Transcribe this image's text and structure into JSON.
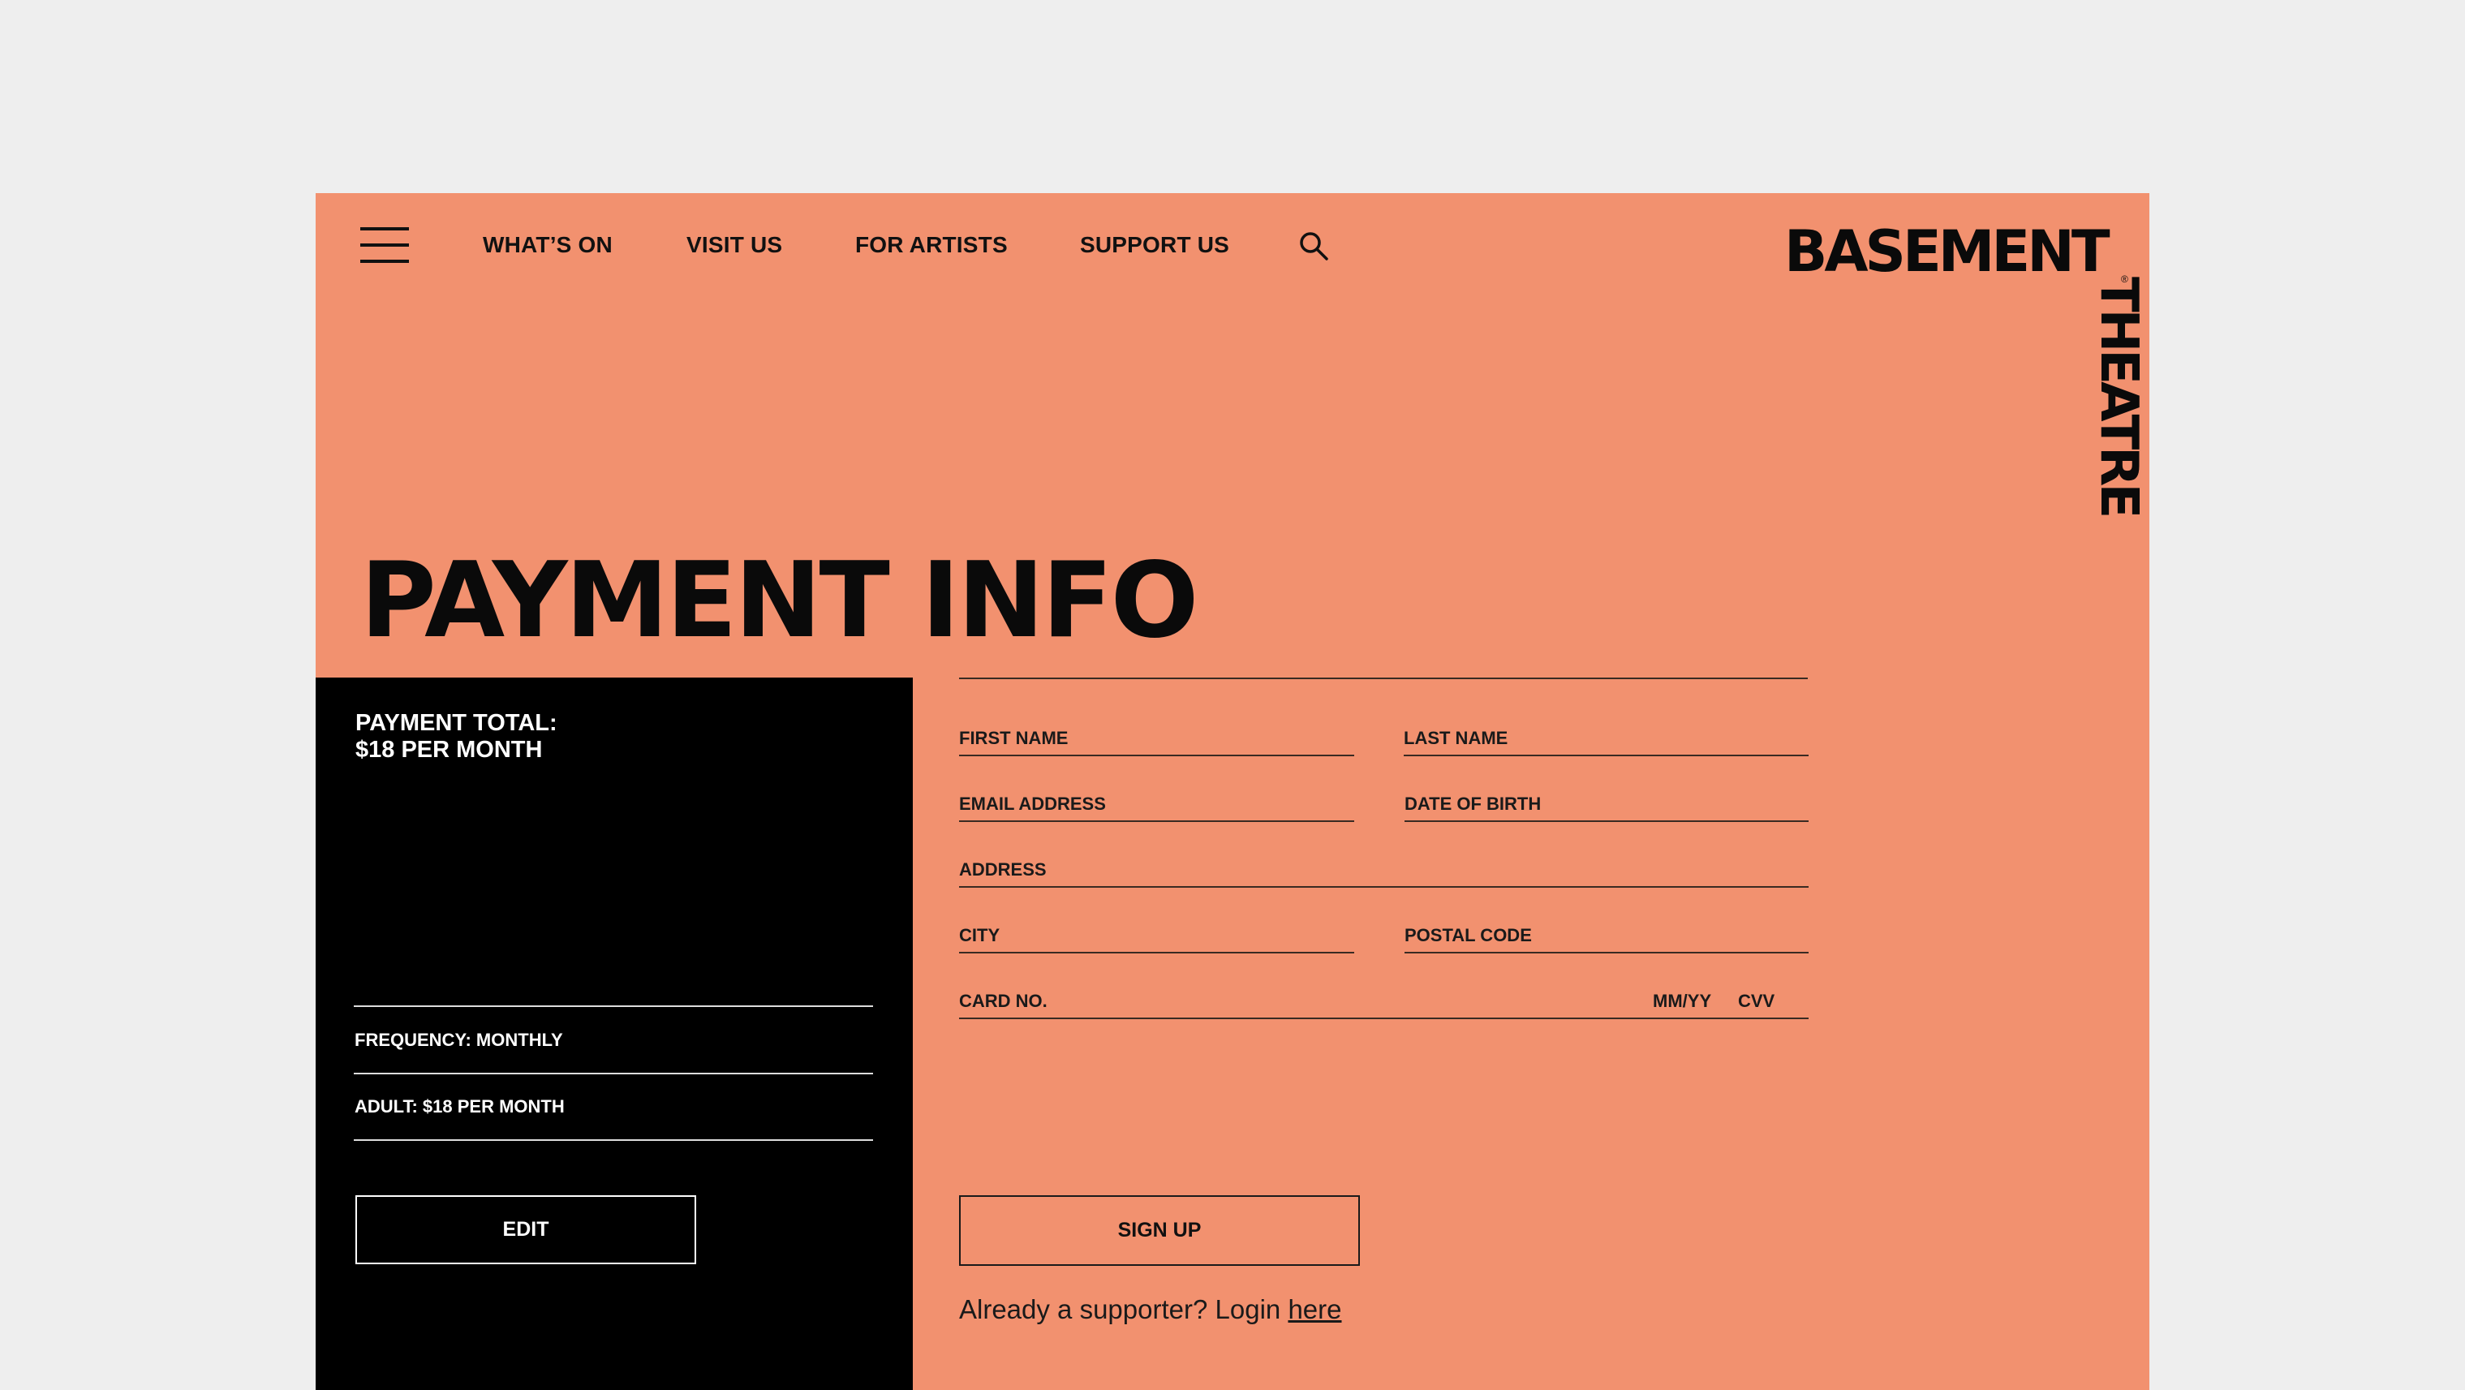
{
  "nav": {
    "items": [
      {
        "label": "WHAT’S ON"
      },
      {
        "label": "VISIT US"
      },
      {
        "label": "FOR ARTISTS"
      },
      {
        "label": "SUPPORT US"
      }
    ],
    "menu_icon": "hamburger-menu-icon",
    "search_icon": "search-icon"
  },
  "logo": {
    "top": "BASEMENT",
    "side": "THEATRE",
    "reg": "®"
  },
  "page": {
    "title": "PAYMENT INFO"
  },
  "summary": {
    "total_line1": "PAYMENT TOTAL:",
    "total_line2": "$18 PER MONTH",
    "frequency": "FREQUENCY: MONTHLY",
    "adult": "ADULT: $18 PER MONTH",
    "edit_label": "EDIT"
  },
  "form": {
    "first_name": "FIRST NAME",
    "last_name": "LAST NAME",
    "email": "EMAIL ADDRESS",
    "dob": "DATE OF BIRTH",
    "address": "ADDRESS",
    "city": "CITY",
    "postal_code": "POSTAL CODE",
    "card_no": "CARD NO.",
    "mmyy": "MM/YY",
    "cvv": "CVV",
    "signup_label": "SIGN UP",
    "login_text": "Already a supporter? Login ",
    "login_link": "here"
  },
  "colors": {
    "background": "#eeeeee",
    "accent": "#f2916f",
    "panel": "#000000",
    "text": "#111111"
  }
}
